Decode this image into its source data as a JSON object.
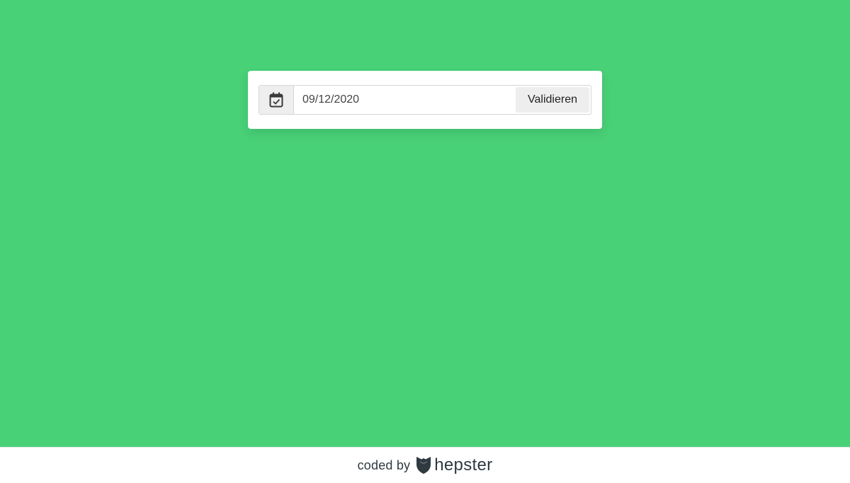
{
  "form": {
    "date_value": "09/12/2020",
    "validate_label": "Validieren",
    "icon": "calendar-check-icon"
  },
  "footer": {
    "coded_by": "coded by",
    "brand": "hepster",
    "brand_icon": "shield-logo-icon"
  },
  "colors": {
    "background": "#48d177",
    "card": "#ffffff",
    "addon": "#eeeeee",
    "text_dark": "#2f3a40"
  }
}
